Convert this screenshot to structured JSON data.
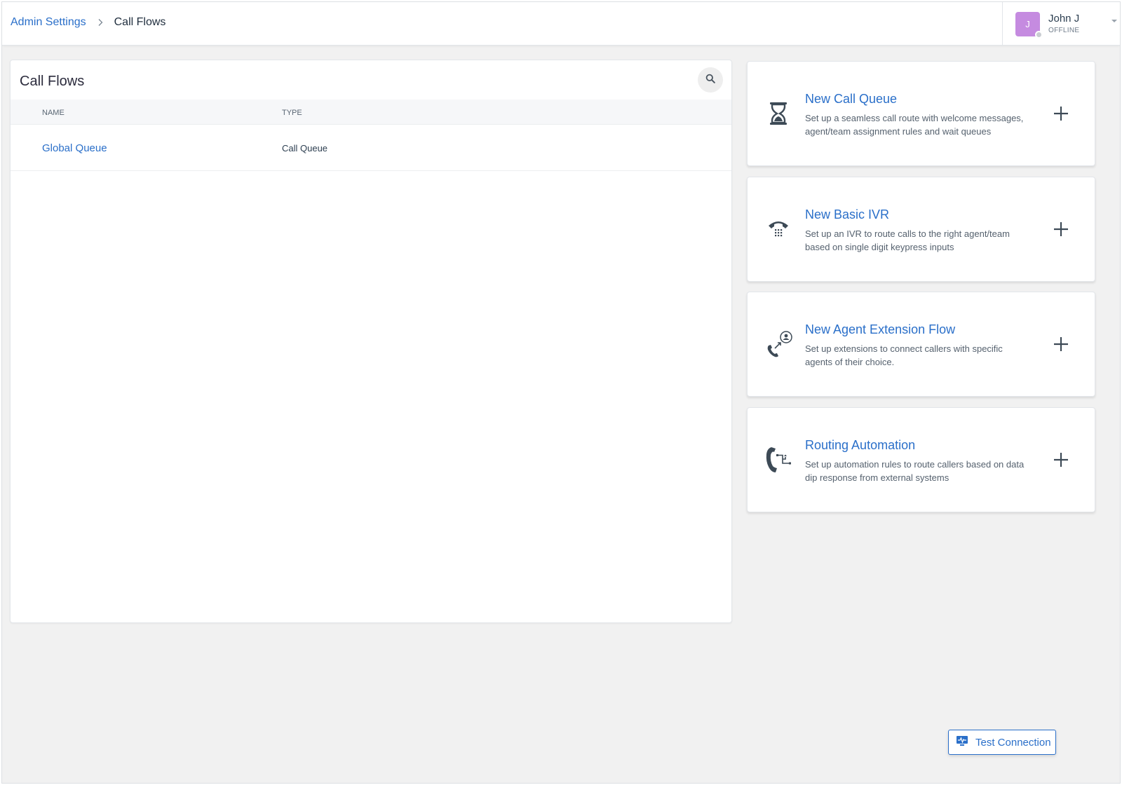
{
  "breadcrumb": {
    "parent": "Admin Settings",
    "current": "Call Flows"
  },
  "user": {
    "initial": "J",
    "name": "John J",
    "status": "OFFLINE"
  },
  "panel": {
    "title": "Call Flows",
    "columns": {
      "name": "NAME",
      "type": "TYPE"
    },
    "rows": [
      {
        "name": "Global Queue",
        "type": "Call Queue"
      }
    ]
  },
  "cards": [
    {
      "title": "New Call Queue",
      "description": "Set up a seamless call route with welcome messages, agent/team assignment rules and wait queues",
      "icon": "hourglass-icon"
    },
    {
      "title": "New Basic IVR",
      "description": "Set up an IVR to route calls to the right agent/team based on single digit keypress inputs",
      "icon": "ivr-phone-icon"
    },
    {
      "title": "New Agent Extension Flow",
      "description": "Set up extensions to connect callers with specific agents of their choice.",
      "icon": "agent-extension-icon"
    },
    {
      "title": "Routing Automation",
      "description": "Set up automation rules to route callers based on data dip response from external systems",
      "icon": "routing-automation-icon"
    }
  ],
  "test_connection": {
    "label": "Test Connection"
  },
  "colors": {
    "link": "#2a6fc9",
    "avatar": "#c58be0",
    "background": "#f1f1f1"
  }
}
